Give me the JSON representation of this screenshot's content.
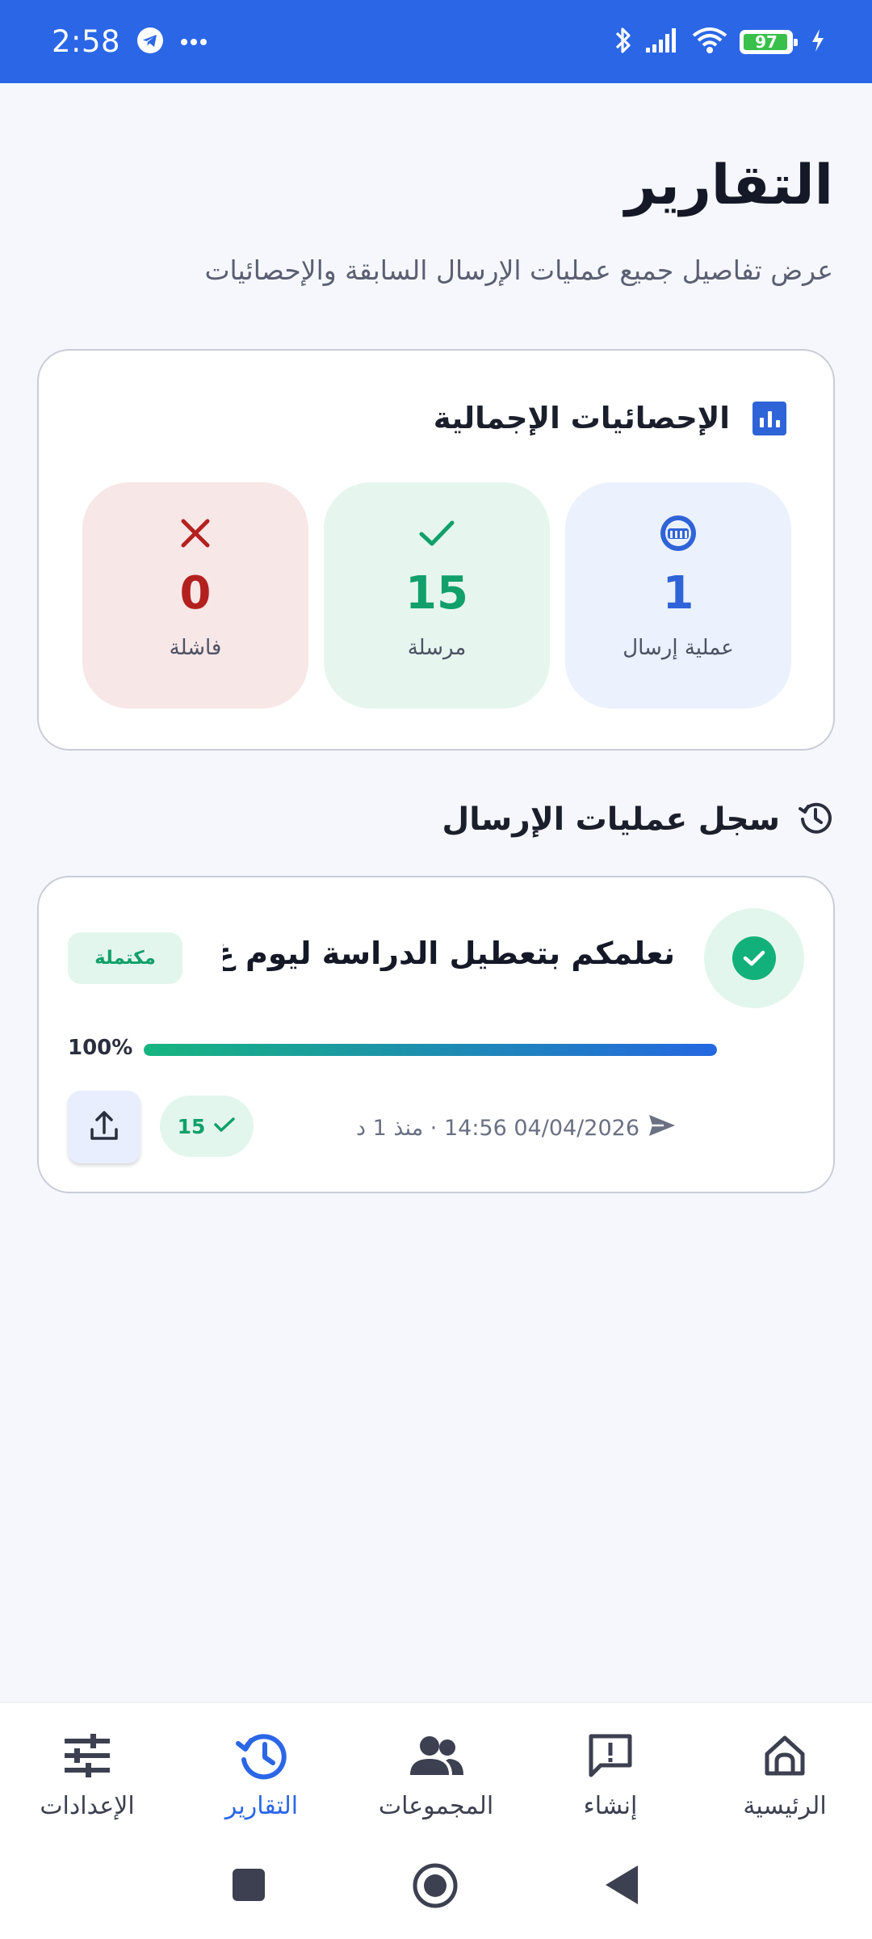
{
  "status_bar": {
    "time": "2:58",
    "battery_level": "97",
    "battery_fraction": 0.97,
    "icons": [
      "telegram-icon",
      "more-dots-icon",
      "bluetooth-icon",
      "signal-icon",
      "wifi-icon",
      "battery-icon",
      "charging-icon"
    ]
  },
  "header": {
    "title": "التقارير",
    "subtitle": "عرض تفاصيل جميع عمليات الإرسال السابقة والإحصائيات"
  },
  "stats": {
    "title": "الإحصائيات الإجمالية",
    "icon": "bar-chart-icon",
    "tiles": [
      {
        "value": "1",
        "label": "عملية إرسال",
        "icon": "send-operation-icon",
        "color": "#2f63d8"
      },
      {
        "value": "15",
        "label": "مرسلة",
        "icon": "check-icon",
        "color": "#11a06a"
      },
      {
        "value": "0",
        "label": "فاشلة",
        "icon": "close-icon",
        "color": "#b3211f"
      }
    ]
  },
  "history": {
    "title": "سجل عمليات الإرسال",
    "icon": "history-icon",
    "operations": [
      {
        "title": "نعلمكم بتعطيل الدراسة ليوم غ...",
        "status": "مكتملة",
        "progress_label": "100%",
        "progress": 1.0,
        "meta": "04/04/2026 14:56 · منذ 1 د",
        "sent_count": "15"
      }
    ]
  },
  "bottom_nav": {
    "items": [
      {
        "label": "الرئيسية",
        "icon": "home-icon",
        "active": false
      },
      {
        "label": "إنشاء",
        "icon": "create-message-icon",
        "active": false
      },
      {
        "label": "المجموعات",
        "icon": "groups-icon",
        "active": false
      },
      {
        "label": "التقارير",
        "icon": "reports-history-icon",
        "active": true
      },
      {
        "label": "الإعدادات",
        "icon": "settings-sliders-icon",
        "active": false
      }
    ]
  },
  "colors": {
    "primary": "#2b66e6",
    "success": "#11a06a",
    "danger": "#b3211f",
    "background": "#f6f7fc"
  }
}
